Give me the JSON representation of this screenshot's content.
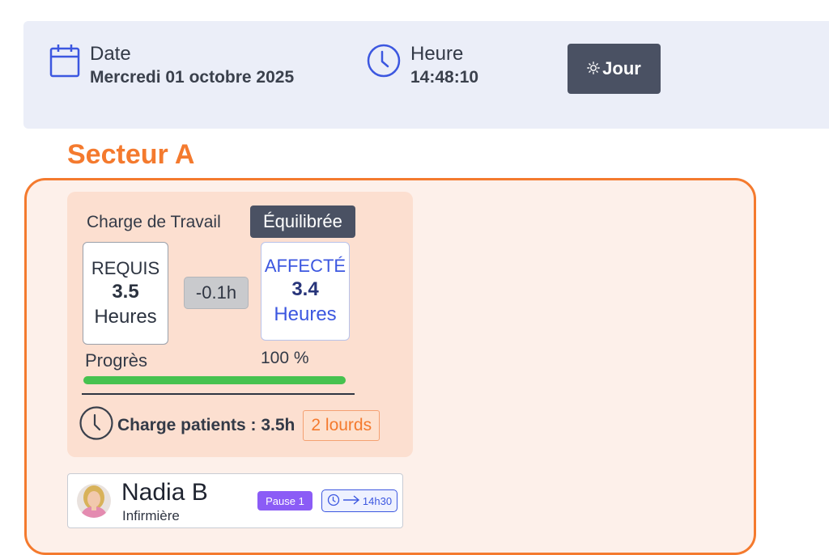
{
  "header": {
    "date_label": "Date",
    "date_value": "Mercredi 01 octobre 2025",
    "time_label": "Heure",
    "time_value": "14:48:10",
    "day_button": "Jour",
    "icons": [
      "calendar-icon",
      "clock-icon",
      "sun-icon"
    ]
  },
  "sector": {
    "title": "Secteur A",
    "accent": "#f47a2e"
  },
  "workload": {
    "title": "Charge de Travail",
    "status": "Équilibrée",
    "required": {
      "label": "REQUIS",
      "value": "3.5",
      "unit": "Heures"
    },
    "difference": "-0.1h",
    "assigned": {
      "label": "AFFECTÉ",
      "value": "3.4",
      "unit": "Heures"
    },
    "progress_label": "Progrès",
    "progress_text": "100 %",
    "progress": 100,
    "patient_load": "Charge patients : 3.5h",
    "heavy_badge": "2 lourds"
  },
  "staff": [
    {
      "name": "Nadia B",
      "role": "Infirmière",
      "pause": "Pause 1",
      "shift_end": "14h30"
    }
  ],
  "colors": {
    "progress": "#46c24f",
    "assigned": "#3c57e0",
    "pause": "#8b5cf6",
    "button": "#4a5163"
  }
}
